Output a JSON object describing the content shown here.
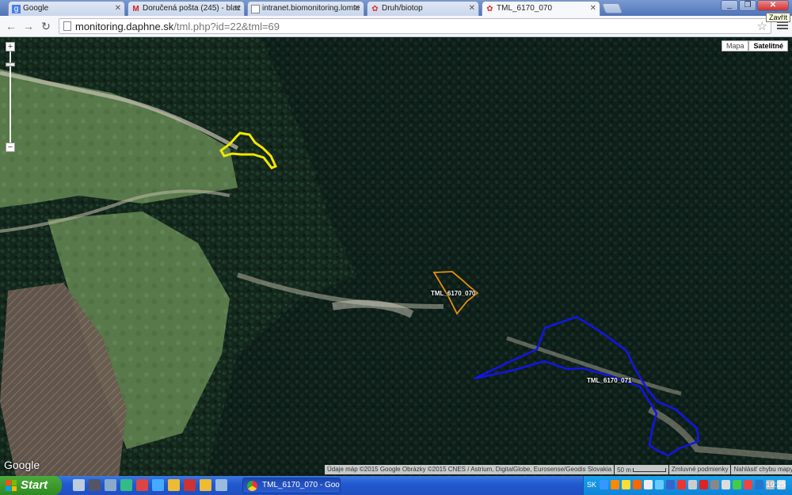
{
  "browser": {
    "tabs": [
      {
        "label": "Google",
        "icon": "google-icon",
        "active": false
      },
      {
        "label": "Doručená pošta (245) - blaz",
        "icon": "gmail-icon",
        "active": false
      },
      {
        "label": "intranet.biomonitoring.lomte",
        "icon": "page-icon",
        "active": false
      },
      {
        "label": "Druh/biotop",
        "icon": "flower-icon",
        "active": false
      },
      {
        "label": "TML_6170_070",
        "icon": "flower-icon",
        "active": true
      }
    ],
    "close_tooltip": "Zavřít",
    "url_host": "monitoring.daphne.sk",
    "url_path": "/tml.php?id=22&tml=69"
  },
  "map": {
    "type_controls": {
      "map": "Mapa",
      "satellite": "Satelitné",
      "selected": "Satelitné"
    },
    "zoom_in": "+",
    "zoom_out": "−",
    "polygons": [
      {
        "label": "",
        "color": "#f2e600"
      },
      {
        "label": "TML_6170_070",
        "color": "#e8900a"
      },
      {
        "label": "TML_6170_071",
        "color": "#1414e6"
      }
    ],
    "google_logo": "Google",
    "attribution": "Údaje máp ©2015 Google Obrázky ©2015 CNES / Astrium, DigitalGlobe, Eurosense/Geodis Slovakia",
    "scale": "50 m",
    "terms": "Zmluvné podmienky",
    "report": "Nahlásiť chybu mapy"
  },
  "taskbar": {
    "start_label": "Start",
    "active_window": "TML_6170_070 - Goo...",
    "language": "SK",
    "time": "19:25"
  }
}
